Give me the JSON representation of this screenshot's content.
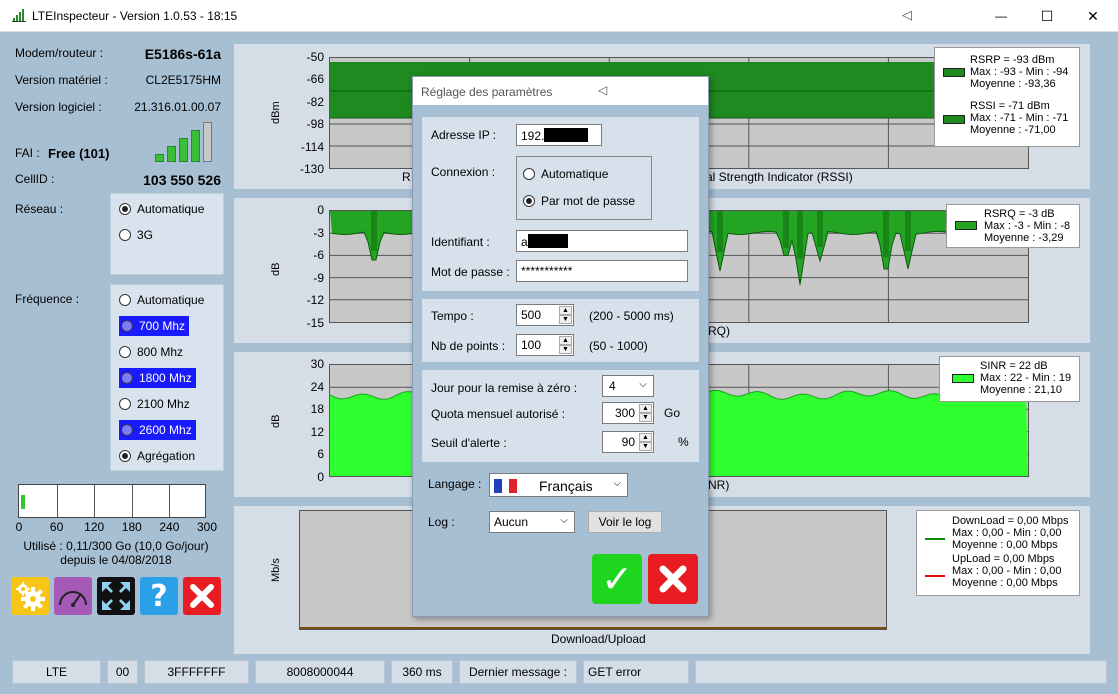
{
  "window": {
    "title": "LTEInspecteur - Version 1.0.53 - 18:15",
    "collapse_glyph": "◁",
    "min_glyph": "—",
    "max_glyph": "☐",
    "close_glyph": "✕"
  },
  "device": {
    "model_label": "Modem/routeur :",
    "model": "E5186s-61a",
    "hw_label": "Version matériel :",
    "hw": "CL2E5175HM",
    "sw_label": "Version logiciel :",
    "sw": "21.316.01.00.07",
    "isp_label": "FAI :",
    "isp": "Free (101)",
    "cellid_label": "CellID :",
    "cellid": "103 550 526",
    "signal_level": 4,
    "signal_max": 5
  },
  "network": {
    "label": "Réseau :",
    "options": [
      {
        "label": "Automatique",
        "selected": true,
        "highlight": false
      },
      {
        "label": "3G",
        "selected": false,
        "highlight": false
      }
    ]
  },
  "frequency": {
    "label": "Fréquence :",
    "options": [
      {
        "label": "Automatique",
        "selected": false,
        "highlight": false
      },
      {
        "label": "700 Mhz",
        "selected": false,
        "highlight": true
      },
      {
        "label": "800 Mhz",
        "selected": false,
        "highlight": false
      },
      {
        "label": "1800 Mhz",
        "selected": false,
        "highlight": true
      },
      {
        "label": "2100 Mhz",
        "selected": false,
        "highlight": false
      },
      {
        "label": "2600 Mhz",
        "selected": false,
        "highlight": true
      },
      {
        "label": "Agrégation",
        "selected": true,
        "highlight": false
      }
    ]
  },
  "usage": {
    "ticks": [
      "0",
      "60",
      "120",
      "180",
      "240",
      "300"
    ],
    "used_gb": 0.11,
    "max_gb": 300,
    "line1": "Utilisé : 0,11/300 Go (10,0 Go/jour)",
    "line2": "depuis le 04/08/2018"
  },
  "toolbar": {
    "settings_icon": "gear-icon",
    "speed_icon": "speedometer-icon",
    "fullscreen_icon": "expand-arrows-icon",
    "help_glyph": "?",
    "help_icon": "help-icon",
    "close_icon": "close-icon",
    "colors": {
      "settings": "#f7c515",
      "speed": "#a65ab8",
      "fullscreen": "#111111",
      "help": "#2aa0e8",
      "close": "#e81c22"
    }
  },
  "charts": {
    "rssi": {
      "ylabel": "dBm",
      "yticks": [
        "-50",
        "-66",
        "-82",
        "-98",
        "-114",
        "-130"
      ],
      "xlabel_left": "R",
      "xlabel_right": "al Strength Indicator (RSSI)",
      "legend": {
        "l1": "RSRP = -93 dBm",
        "l2": "Max : -93 - Min : -94",
        "l3": "Moyenne : -93,36",
        "l4": "RSSI = -71 dBm",
        "l5": "Max : -71 - Min : -71",
        "l6": "Moyenne : -71,00"
      }
    },
    "rsrq": {
      "ylabel": "dB",
      "yticks": [
        "0",
        "-3",
        "-6",
        "-9",
        "-12",
        "-15"
      ],
      "xlabel_right": "RQ)",
      "legend": {
        "l1": "RSRQ = -3 dB",
        "l2": "Max : -3 - Min : -8",
        "l3": "Moyenne : -3,29"
      }
    },
    "sinr": {
      "ylabel": "dB",
      "yticks": [
        "30",
        "24",
        "18",
        "12",
        "6",
        "0"
      ],
      "xlabel_right": "NR)",
      "legend": {
        "l1": "SINR = 22 dB",
        "l2": "Max : 22 - Min : 19",
        "l3": "Moyenne : 21,10"
      }
    },
    "throughput": {
      "ylabel": "Mb/s",
      "xlabel": "Download/Upload",
      "legend": {
        "l1": "DownLoad = 0,00 Mbps",
        "l2": "Max : 0,00 - Min : 0,00",
        "l3": "Moyenne : 0,00 Mbps",
        "l4": "UpLoad = 0,00 Mbps",
        "l5": "Max : 0,00 - Min : 0,00",
        "l6": "Moyenne : 0,00 Mbps"
      }
    },
    "colors": {
      "rsrp": "#1f8a1f",
      "rsrq": "#23a523",
      "sinr": "#2fff2f",
      "download": "#0a8a0a",
      "upload": "#e01010"
    }
  },
  "dialog": {
    "title": "Réglage des paramètres",
    "collapse_glyph": "◁",
    "ip_label": "Adresse IP :",
    "ip_value": "192.",
    "conn_label": "Connexion :",
    "conn_auto": "Automatique",
    "conn_pwd": "Par mot de passe",
    "id_label": "Identifiant :",
    "id_value": "a",
    "pwd_label": "Mot de passe :",
    "pwd_value": "***********",
    "tempo_label": "Tempo :",
    "tempo_value": "500",
    "tempo_range": "(200 - 5000 ms)",
    "points_label": "Nb de points :",
    "points_value": "100",
    "points_range": "(50 - 1000)",
    "reset_label": "Jour pour la remise à zéro :",
    "reset_value": "4",
    "quota_label": "Quota mensuel autorisé :",
    "quota_value": "300",
    "quota_unit": "Go",
    "alert_label": "Seuil d'alerte :",
    "alert_value": "90",
    "alert_unit": "%",
    "lang_label": "Langage :",
    "lang_value": "Français",
    "log_label": "Log :",
    "log_value": "Aucun",
    "view_log": "Voir le log",
    "spin_up": "▲",
    "spin_down": "▼",
    "chevron": "⌵",
    "ok_glyph": "✓",
    "ok_color": "#1ed61e",
    "cancel_color": "#e81c22"
  },
  "statusbar": {
    "mode": "LTE",
    "code": "00",
    "mask": "3FFFFFFF",
    "band": "8008000044",
    "latency": "360 ms",
    "msg_label": "Dernier message :",
    "msg": "GET error"
  }
}
